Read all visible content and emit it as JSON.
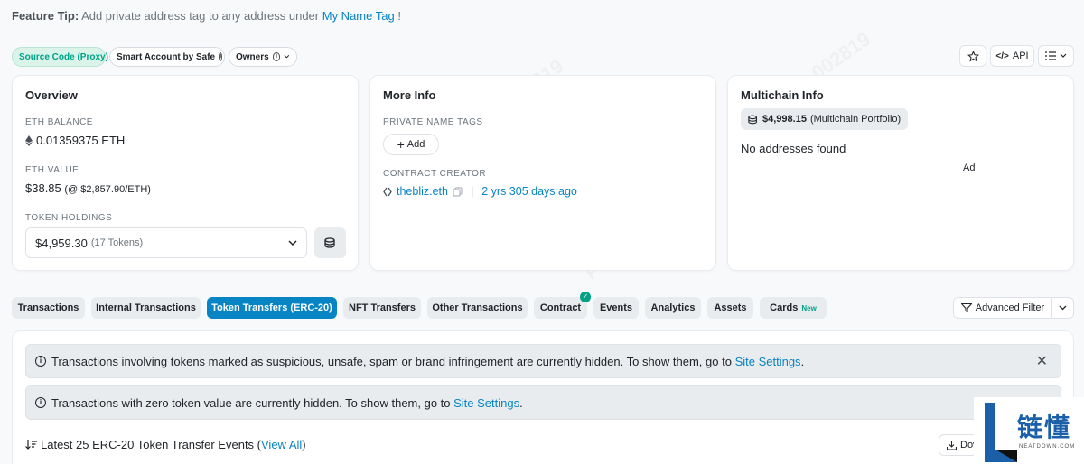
{
  "feature_tip": {
    "label": "Feature Tip:",
    "text": " Add private address tag to any address under ",
    "link": "My Name Tag",
    "end": " !"
  },
  "header_pills": {
    "source_code": "Source Code (Proxy)",
    "smart_account": "Smart Account by Safe",
    "owners": "Owners"
  },
  "toolbar": {
    "api_label": "API"
  },
  "overview": {
    "title": "Overview",
    "eth_balance_label": "ETH BALANCE",
    "eth_balance_value": "0.01359375 ETH",
    "eth_value_label": "ETH VALUE",
    "eth_value_value": "$38.85",
    "eth_value_rate": "(@ $2,857.90/ETH)",
    "token_holdings_label": "TOKEN HOLDINGS",
    "token_holdings_value": "$4,959.30",
    "token_holdings_count": "(17 Tokens)"
  },
  "more_info": {
    "title": "More Info",
    "private_tags_label": "PRIVATE NAME TAGS",
    "add_label": "Add",
    "creator_label": "CONTRACT CREATOR",
    "creator_name": "thebliz.eth",
    "separator": "|",
    "creator_age": "2 yrs 305 days ago"
  },
  "multichain": {
    "title": "Multichain Info",
    "portfolio_value": "$4,998.15",
    "portfolio_label": "(Multichain Portfolio)",
    "no_addresses": "No addresses found",
    "ad_label": "Ad"
  },
  "tabs": [
    {
      "label": "Transactions"
    },
    {
      "label": "Internal Transactions"
    },
    {
      "label": "Token Transfers (ERC-20)",
      "active": true
    },
    {
      "label": "NFT Transfers"
    },
    {
      "label": "Other Transactions"
    },
    {
      "label": "Contract"
    },
    {
      "label": "Events"
    },
    {
      "label": "Analytics"
    },
    {
      "label": "Assets"
    },
    {
      "label": "Cards",
      "badge": "New"
    }
  ],
  "advanced_filter": "Advanced Filter",
  "alerts": [
    {
      "text": "Transactions involving tokens marked as suspicious, unsafe, spam or brand infringement are currently hidden. To show them, go to ",
      "link": "Site Settings",
      "end": "."
    },
    {
      "text": "Transactions with zero token value are currently hidden. To show them, go to ",
      "link": "Site Settings",
      "end": "."
    }
  ],
  "events_header": {
    "text": "Latest 25 ERC-20 Token Transfer Events (",
    "link": "View All",
    "end": ")",
    "download_label": "Dov"
  },
  "watermark": {
    "brand": "链懂",
    "sub": "NEATDOWN.COM",
    "code": "PC-002819"
  },
  "colors": {
    "accent": "#0784c3",
    "green": "#00a186",
    "tab_bg": "#e9ecef"
  }
}
